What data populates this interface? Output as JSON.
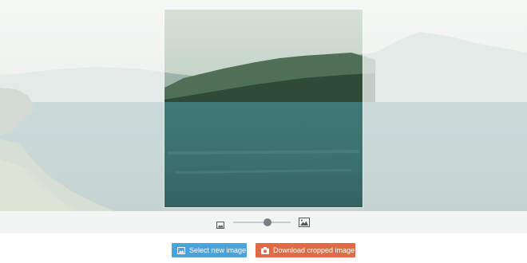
{
  "cropper": {
    "zoom_level": 0.6
  },
  "actions": {
    "select_label": "Select new image",
    "download_label": "Download cropped image"
  },
  "icons": {
    "zoom_out": "image-small-icon",
    "zoom_in": "image-large-icon",
    "select": "image-icon",
    "download": "camera-icon"
  },
  "colors": {
    "select_button": "#4aa3db",
    "download_button": "#e06a45",
    "slider_knob": "#7a7f83"
  }
}
